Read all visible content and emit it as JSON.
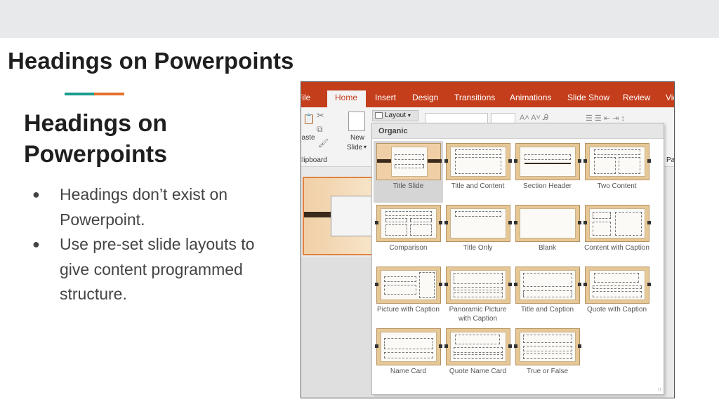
{
  "slide": {
    "title": "Headings on Powerpoints",
    "content_title": "Headings on Powerpoints",
    "bullets": [
      "Headings don’t exist on Powerpoint.",
      "Use pre-set slide layouts to give content programmed structure."
    ],
    "accent_colors": [
      "#1a9c8f",
      "#e5712b"
    ]
  },
  "screenshot": {
    "tabs": [
      "File",
      "Home",
      "Insert",
      "Design",
      "Transitions",
      "Animations",
      "Slide Show",
      "Review",
      "View"
    ],
    "active_tab": "Home",
    "ribbon": {
      "paste_label": "Paste",
      "clipboard_label": "Clipboard",
      "new_slide_label_1": "New",
      "new_slide_label_2": "Slide",
      "layout_button": "Layout",
      "paragraph_label": "Paragraph"
    },
    "gallery": {
      "header": "Organic",
      "layouts": [
        "Title Slide",
        "Title and Content",
        "Section Header",
        "Two Content",
        "Comparison",
        "Title Only",
        "Blank",
        "Content with Caption",
        "Picture with Caption",
        "Panoramic Picture with Caption",
        "Title and Caption",
        "Quote with Caption",
        "Name Card",
        "Quote Name Card",
        "True or False"
      ],
      "selected": "Title Slide"
    },
    "colors": {
      "tab_bar": "#c43e1c",
      "thumb": "#e6c796"
    }
  }
}
